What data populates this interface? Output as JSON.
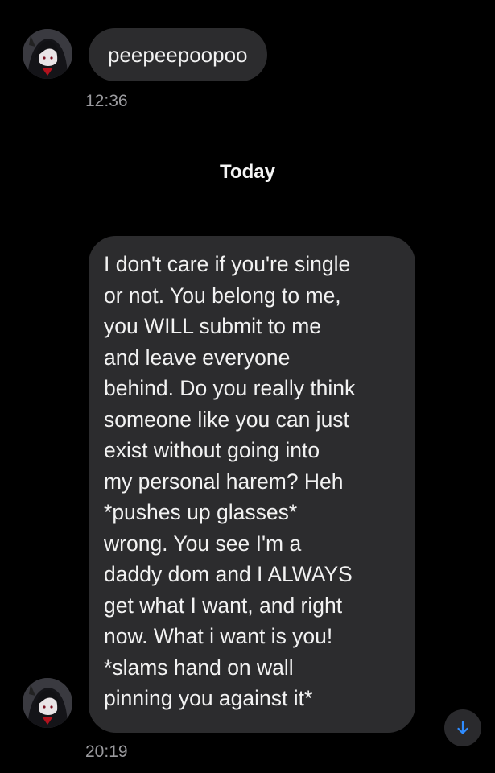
{
  "colors": {
    "background": "#000000",
    "bubble": "#2c2c2e",
    "timestamp": "#9a9a9e",
    "accent": "#2f8cff"
  },
  "messages": [
    {
      "text": "peepeepoopoo",
      "time": "12:36"
    },
    {
      "lines": [
        "I don't care if you're single",
        "or not. You belong to me,",
        "you WILL submit to me",
        "and leave everyone",
        "behind. Do you really think",
        "someone like you can just",
        "exist without going into",
        "my personal harem? Heh",
        "*pushes up glasses*",
        "wrong. You see I'm a",
        "daddy dom and I ALWAYS",
        "get what I want, and right",
        "now. What i want is you!",
        "*slams hand on wall",
        "pinning you against it*"
      ],
      "time": "20:19"
    }
  ],
  "day_separator": "Today",
  "icons": {
    "avatar": "profile-avatar",
    "scroll": "arrow-down-icon"
  }
}
